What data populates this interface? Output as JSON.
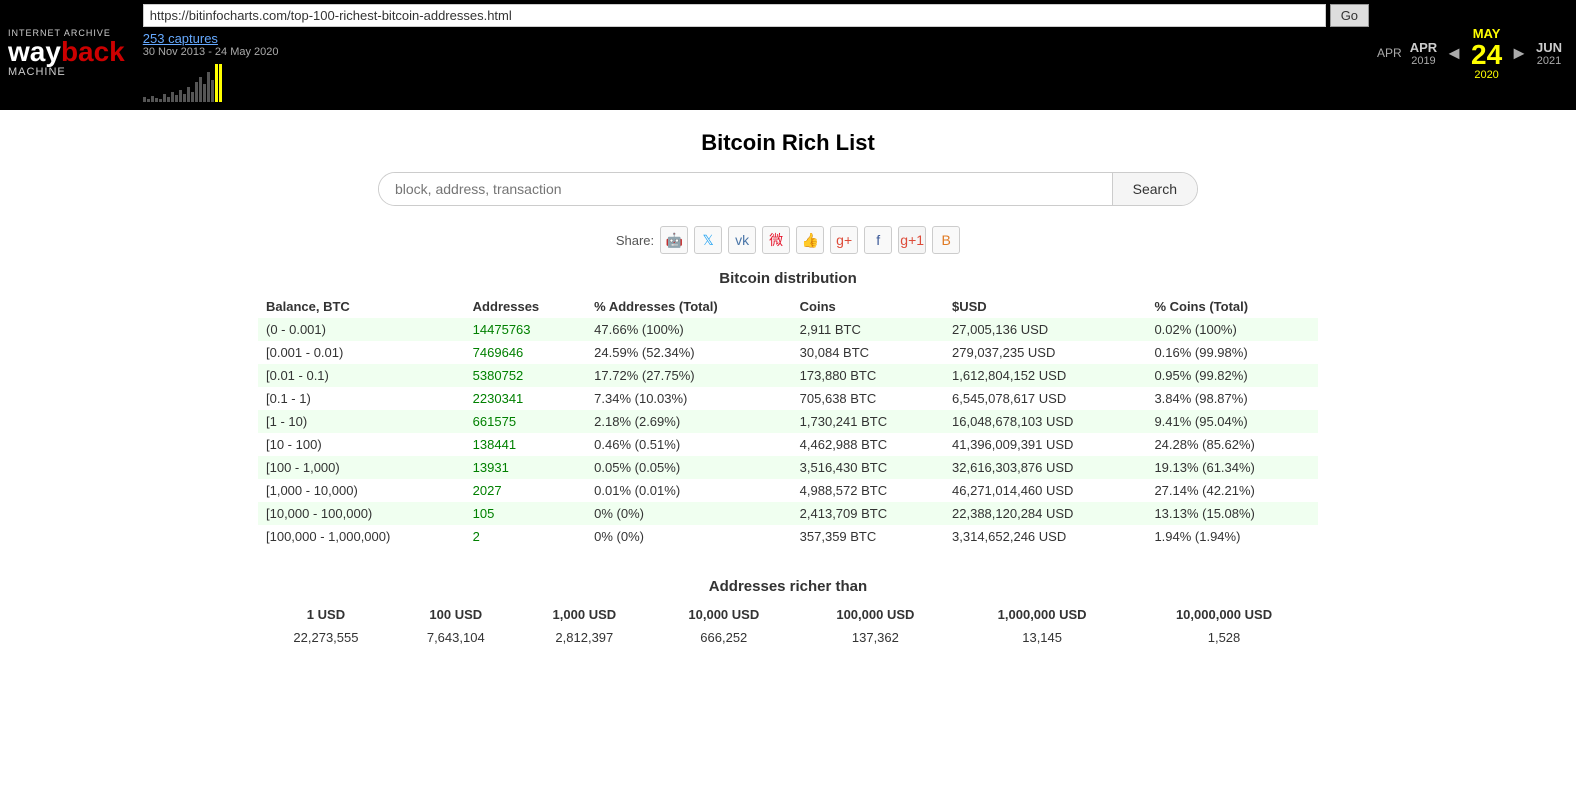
{
  "wayback": {
    "logo": {
      "internet_archive": "INTERNET ARCHIVE",
      "wayback": "wayback",
      "machine": "Machine"
    },
    "url": "https://bitinfocharts.com/top-100-richest-bitcoin-addresses.html",
    "go_label": "Go",
    "captures_link": "253 captures",
    "captures_date": "30 Nov 2013 - 24 May 2020",
    "months": [
      {
        "name": "APR",
        "year": "2019",
        "day": "",
        "active": false
      },
      {
        "name": "MAY",
        "year": "2020",
        "day": "24",
        "active": true
      },
      {
        "name": "JUN",
        "year": "2021",
        "day": "",
        "active": false
      }
    ],
    "prev_arrow": "◄",
    "next_arrow": "►"
  },
  "page": {
    "title": "Bitcoin Rich List",
    "search_placeholder": "block, address, transaction",
    "search_label": "Search"
  },
  "share": {
    "label": "Share:"
  },
  "distribution": {
    "section_title": "Bitcoin distribution",
    "columns": [
      "Balance, BTC",
      "Addresses",
      "% Addresses (Total)",
      "Coins",
      "$USD",
      "% Coins (Total)"
    ],
    "rows": [
      {
        "balance": "(0 - 0.001)",
        "addresses": "14475763",
        "pct_addr": "47.66% (100%)",
        "coins": "2,911 BTC",
        "usd": "27,005,136 USD",
        "pct_coins": "0.02% (100%)",
        "even": true
      },
      {
        "balance": "[0.001 - 0.01)",
        "addresses": "7469646",
        "pct_addr": "24.59% (52.34%)",
        "coins": "30,084 BTC",
        "usd": "279,037,235 USD",
        "pct_coins": "0.16% (99.98%)",
        "even": false
      },
      {
        "balance": "[0.01 - 0.1)",
        "addresses": "5380752",
        "pct_addr": "17.72% (27.75%)",
        "coins": "173,880 BTC",
        "usd": "1,612,804,152 USD",
        "pct_coins": "0.95% (99.82%)",
        "even": true
      },
      {
        "balance": "[0.1 - 1)",
        "addresses": "2230341",
        "pct_addr": "7.34% (10.03%)",
        "coins": "705,638 BTC",
        "usd": "6,545,078,617 USD",
        "pct_coins": "3.84% (98.87%)",
        "even": false
      },
      {
        "balance": "[1 - 10)",
        "addresses": "661575",
        "pct_addr": "2.18% (2.69%)",
        "coins": "1,730,241 BTC",
        "usd": "16,048,678,103 USD",
        "pct_coins": "9.41% (95.04%)",
        "even": true
      },
      {
        "balance": "[10 - 100)",
        "addresses": "138441",
        "pct_addr": "0.46% (0.51%)",
        "coins": "4,462,988 BTC",
        "usd": "41,396,009,391 USD",
        "pct_coins": "24.28% (85.62%)",
        "even": false
      },
      {
        "balance": "[100 - 1,000)",
        "addresses": "13931",
        "pct_addr": "0.05% (0.05%)",
        "coins": "3,516,430 BTC",
        "usd": "32,616,303,876 USD",
        "pct_coins": "19.13% (61.34%)",
        "even": true
      },
      {
        "balance": "[1,000 - 10,000)",
        "addresses": "2027",
        "pct_addr": "0.01% (0.01%)",
        "coins": "4,988,572 BTC",
        "usd": "46,271,014,460 USD",
        "pct_coins": "27.14% (42.21%)",
        "even": false
      },
      {
        "balance": "[10,000 - 100,000)",
        "addresses": "105",
        "pct_addr": "0% (0%)",
        "coins": "2,413,709 BTC",
        "usd": "22,388,120,284 USD",
        "pct_coins": "13.13% (15.08%)",
        "even": true
      },
      {
        "balance": "[100,000 - 1,000,000)",
        "addresses": "2",
        "pct_addr": "0% (0%)",
        "coins": "357,359 BTC",
        "usd": "3,314,652,246 USD",
        "pct_coins": "1.94% (1.94%)",
        "even": false
      }
    ]
  },
  "richer": {
    "title": "Addresses richer than",
    "columns": [
      "1 USD",
      "100 USD",
      "1,000 USD",
      "10,000 USD",
      "100,000 USD",
      "1,000,000 USD",
      "10,000,000 USD"
    ],
    "values": [
      "22,273,555",
      "7,643,104",
      "2,812,397",
      "666,252",
      "137,362",
      "13,145",
      "1,528"
    ]
  }
}
